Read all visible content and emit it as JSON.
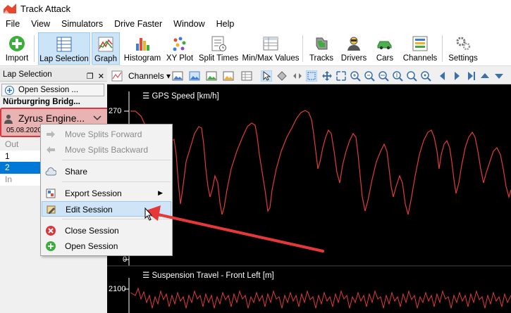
{
  "window": {
    "title": "Track Attack"
  },
  "menu": [
    "File",
    "View",
    "Simulators",
    "Drive Faster",
    "Window",
    "Help"
  ],
  "toolbar": {
    "import": "Import",
    "lap_selection": "Lap Selection",
    "graph": "Graph",
    "histogram": "Histogram",
    "xy_plot": "XY Plot",
    "split_times": "Split Times",
    "minmax": "Min/Max Values",
    "tracks": "Tracks",
    "drivers": "Drivers",
    "cars": "Cars",
    "channels": "Channels",
    "settings": "Settings"
  },
  "lap_panel": {
    "title": "Lap Selection",
    "open_session": "Open Session ...",
    "track": "Nürburgring Bridg...",
    "session_name": "Zyrus Engine...",
    "session_date": "05.08.2020",
    "laps": [
      "Out",
      "1",
      "2",
      "In"
    ]
  },
  "graph_toolbar": {
    "channels": "Channels"
  },
  "graphs": {
    "speed_title": "GPS Speed [km/h]",
    "speed_ytop": "270",
    "speed_ybottom": "0",
    "susp_title": "Suspension Travel - Front Left [m]",
    "susp_ytop": "2100"
  },
  "context_menu": {
    "move_forward": "Move Splits Forward",
    "move_backward": "Move Splits Backward",
    "share": "Share",
    "export": "Export Session",
    "edit": "Edit Session",
    "close": "Close Session",
    "open": "Open Session"
  },
  "colors": {
    "accent_red": "#d9363e",
    "graph_line": "#e23b3b",
    "highlight": "#cfe4f7"
  }
}
